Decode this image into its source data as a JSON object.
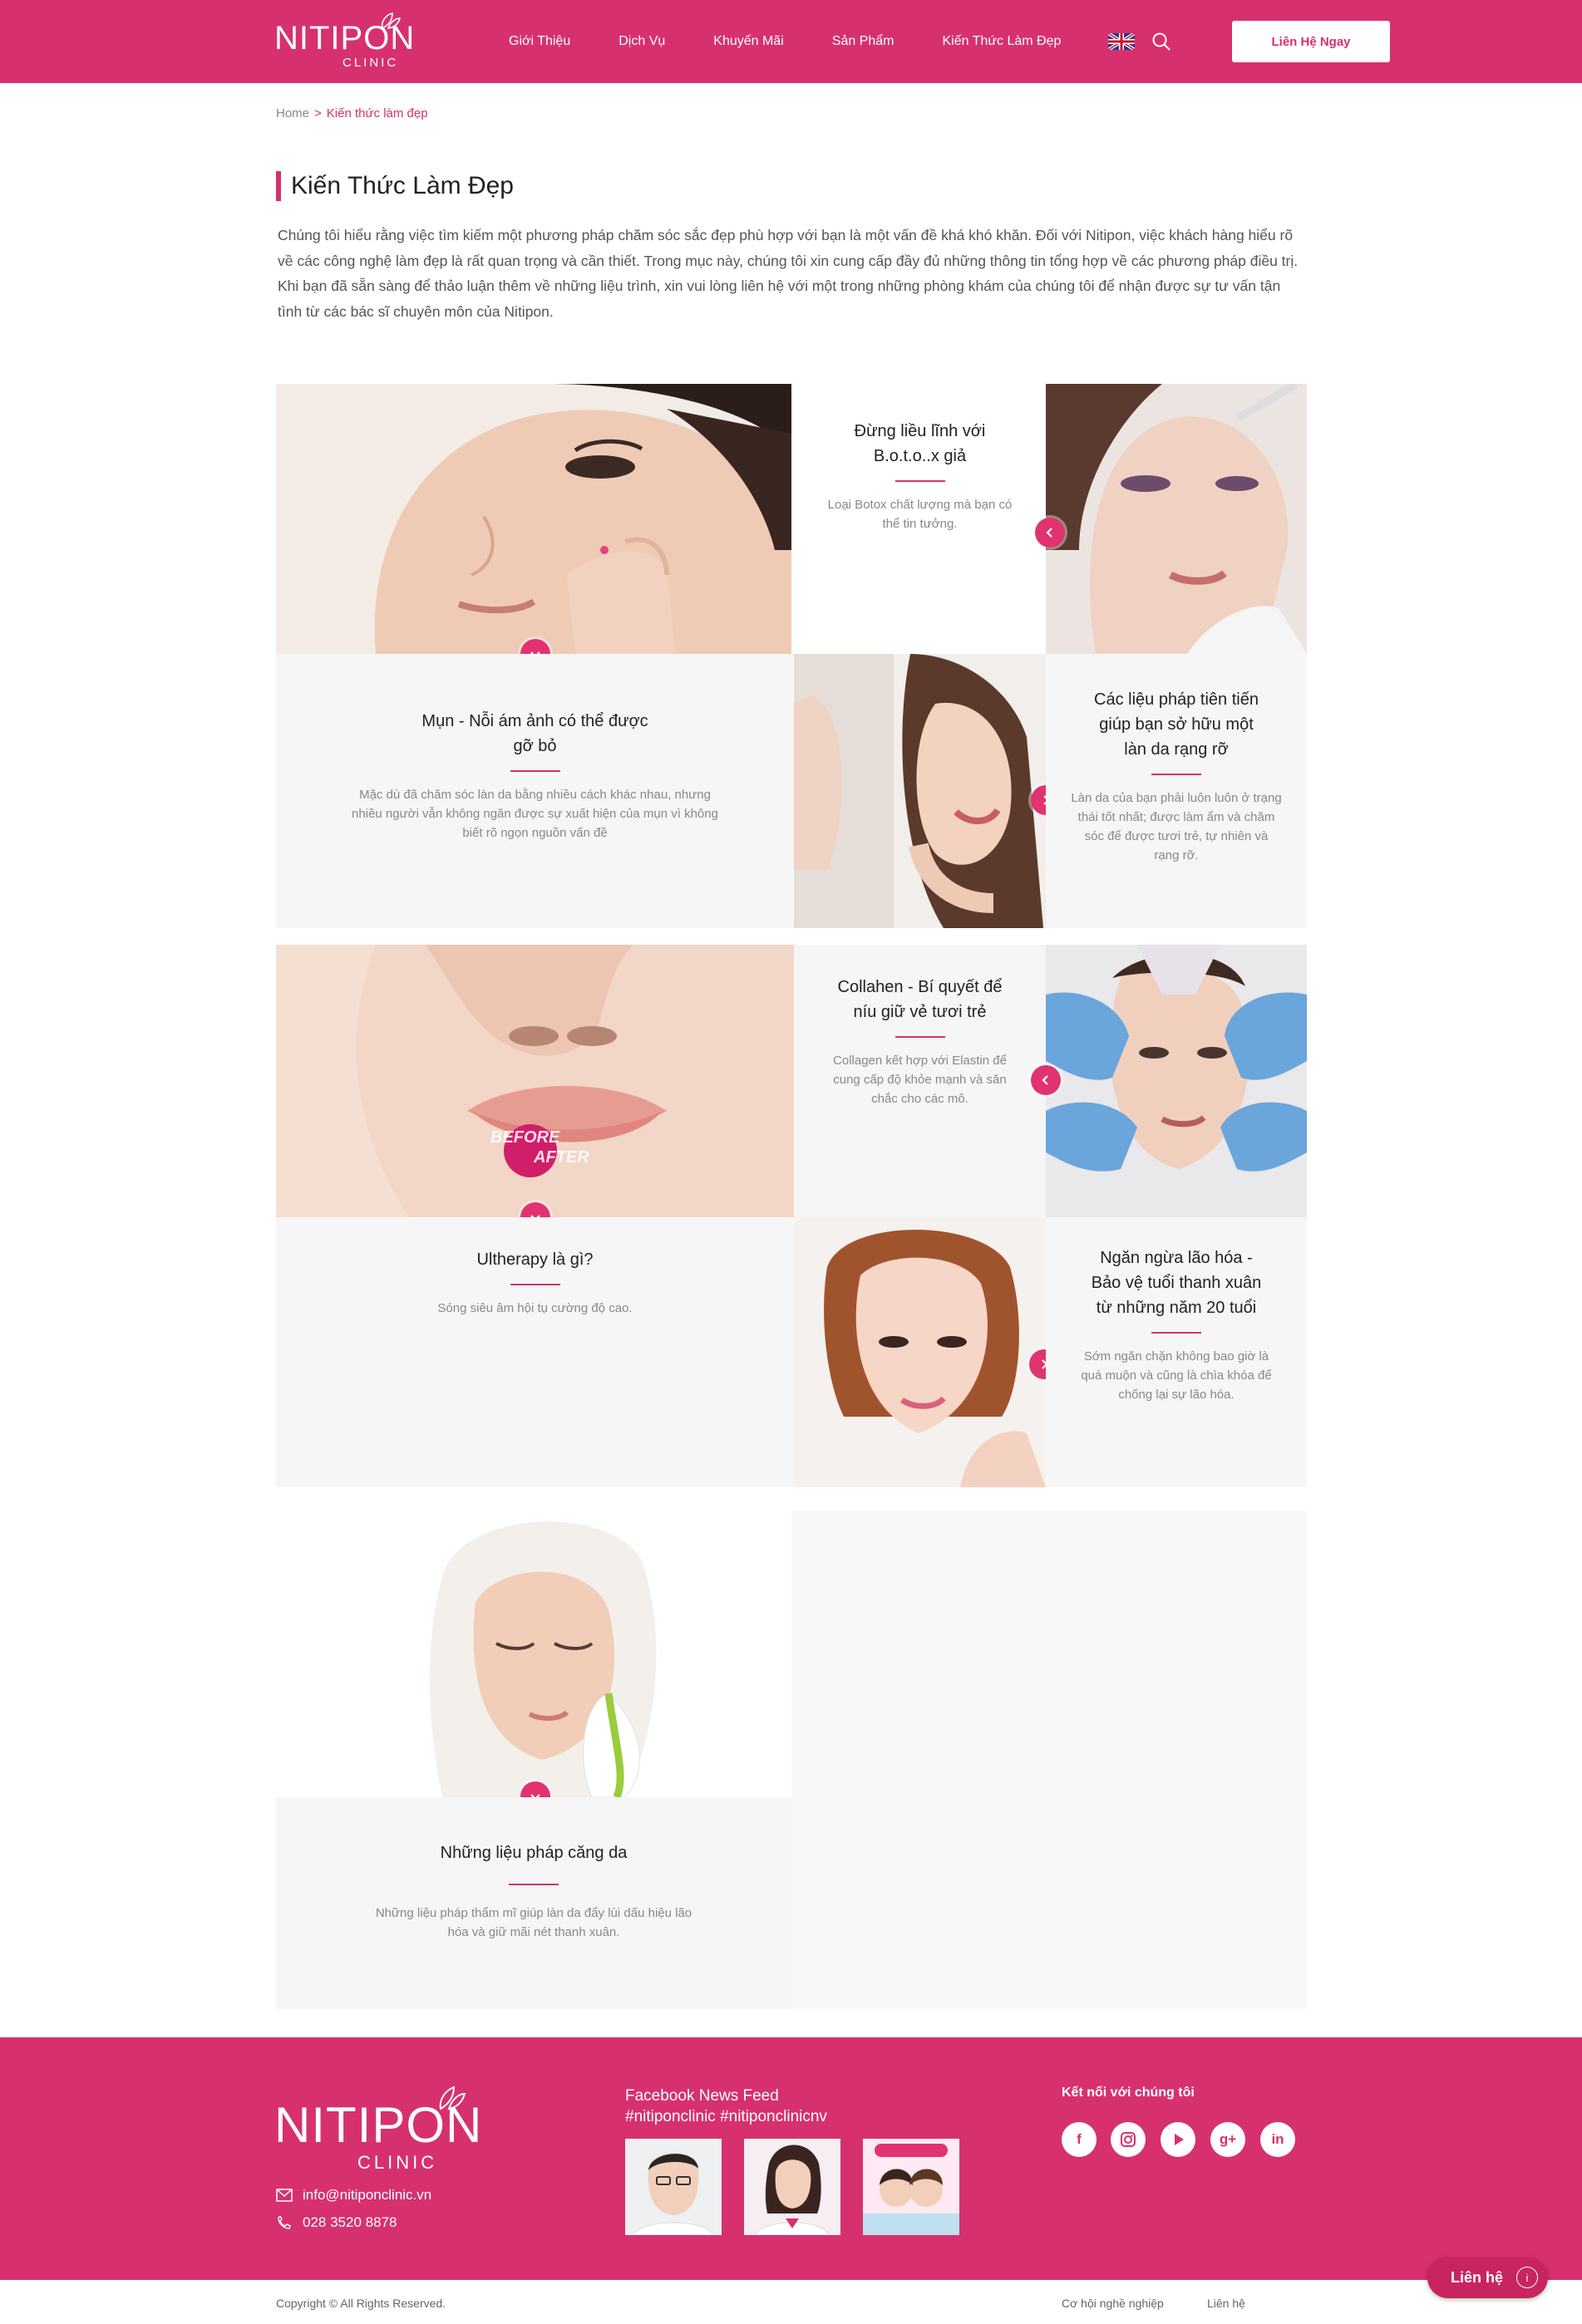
{
  "header": {
    "logo_main": "NITIPON",
    "logo_sub": "CLINIC",
    "nav": [
      "Giới Thiệu",
      "Dịch Vụ",
      "Khuyến Mãi",
      "Sản Phẩm",
      "Kiến Thức Làm Đẹp"
    ],
    "language_icon": "uk-flag-icon",
    "search_icon": "search-icon",
    "contact_button": "Liên Hệ Ngay"
  },
  "breadcrumb": {
    "home": "Home",
    "separator": ">",
    "current": "Kiến thức làm đẹp"
  },
  "page": {
    "title": "Kiến Thức Làm Đẹp",
    "intro": "Chúng tôi hiểu rằng việc tìm kiếm một phương pháp chăm sóc sắc đẹp phù hợp với bạn là một vấn đề khá khó khăn. Đối với Nitipon, việc khách hàng hiểu rõ về các công nghệ làm đẹp là rất quan trọng và cần thiết. Trong mục này, chúng tôi xin cung cấp đầy đủ những thông tin tổng hợp về các phương pháp điều trị. Khi bạn đã sẵn sàng để thảo luận thêm về những liệu trình, xin vui lòng liên hệ với một trong những phòng khám của chúng tôi để nhận được sự tư vấn tận tình từ các bác sĩ chuyên môn của Nitipon."
  },
  "articles": {
    "botox": {
      "title_1": "Đừng liều lĩnh với",
      "title_2": "B.o.t.o..x giả",
      "desc": "Loại Botox chất lượng mà bạn có thể tin tưởng."
    },
    "acne": {
      "title_1": "Mụn - Nỗi ám ảnh có thể được",
      "title_2": "gỡ bỏ",
      "desc": "Mặc dù đã chăm sóc làn da bằng nhiều cách khác nhau, nhưng nhiều người vẫn không ngăn được sự xuất hiện của mụn vì không biết rõ ngọn nguồn vấn đề"
    },
    "glow": {
      "title_1": "Các liệu pháp tiên tiến",
      "title_2": "giúp bạn sở hữu một",
      "title_3": "làn da rạng rỡ",
      "desc": "Làn da của bạn phải luôn luôn ở trạng thái tốt nhất; được làm ẩm và chăm sóc để được tươi trẻ, tự nhiên và rạng rỡ."
    },
    "collagen": {
      "title_1": "Collahen - Bí quyết để",
      "title_2": "níu giữ vẻ tươi trẻ",
      "desc": "Collagen kết hợp với Elastin để cung cấp độ khỏe mạnh và săn chắc cho các mô."
    },
    "ultherapy": {
      "title_1": "Ultherapy là gì?",
      "desc": "Sóng siêu âm hội tụ cường độ cao.",
      "overlay_before": "BEFORE",
      "overlay_after": "AFTER"
    },
    "aging": {
      "title_1": "Ngăn ngừa lão hóa -",
      "title_2": "Bảo vệ tuổi thanh xuân",
      "title_3": "từ những năm 20 tuổi",
      "desc": "Sớm ngăn chặn không bao giờ là quá muộn và cũng là chìa khóa để chống lại sự lão hóa."
    },
    "tightening": {
      "title_1": "Những liệu pháp căng da",
      "desc": "Những liệu pháp thẩm mĩ giúp làn da đẩy lùi dấu hiệu lão hóa và giữ mãi nét thanh xuân."
    }
  },
  "footer": {
    "logo_main": "NITIPON",
    "logo_sub": "CLINIC",
    "email": "info@nitiponclinic.vn",
    "phone": "028 3520 8878",
    "fb_title_1": "Facebook News Feed",
    "fb_title_2": "#nitiponclinic #nitiponclinicnv",
    "connect_title": "Kết nối với chúng tôi",
    "social": [
      "f",
      "ig",
      "yt",
      "g+",
      "in"
    ],
    "copyright": "Copyright © All Rights Reserved.",
    "link_careers": "Cơ hội nghề nghiệp",
    "link_contact": "Liên hệ",
    "chat_label": "Liên hệ",
    "chat_info": "i"
  },
  "colors": {
    "brand": "#d7306f",
    "panel_bg": "#f6f6f6",
    "dot": "#e0336f"
  }
}
